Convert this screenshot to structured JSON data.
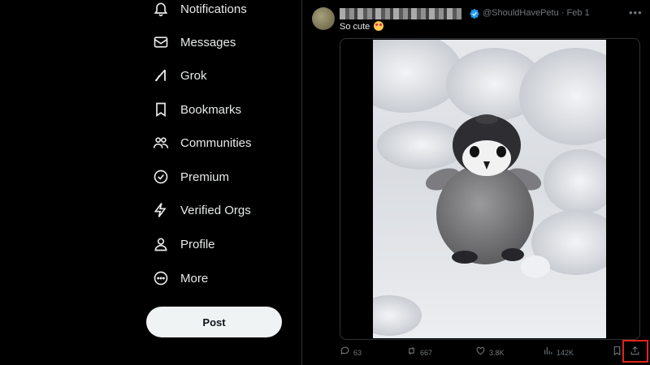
{
  "sidebar": {
    "items": [
      {
        "label": "Notifications",
        "icon": "bell-icon"
      },
      {
        "label": "Messages",
        "icon": "envelope-icon"
      },
      {
        "label": "Grok",
        "icon": "grok-icon"
      },
      {
        "label": "Bookmarks",
        "icon": "bookmark-icon"
      },
      {
        "label": "Communities",
        "icon": "people-icon"
      },
      {
        "label": "Premium",
        "icon": "premium-badge-icon"
      },
      {
        "label": "Verified Orgs",
        "icon": "lightning-icon"
      },
      {
        "label": "Profile",
        "icon": "person-icon"
      },
      {
        "label": "More",
        "icon": "more-circle-icon"
      }
    ],
    "post_label": "Post"
  },
  "tweet": {
    "handle": "@ShouldHavePetu · Feb 1",
    "text": "So cute",
    "actions": {
      "replies": "63",
      "reposts": "667",
      "likes": "3.8K",
      "views": "142K"
    }
  },
  "colors": {
    "background": "#000000",
    "text": "#e7e9ea",
    "muted": "#71767b",
    "verified": "#1d9bf0",
    "post_button_bg": "#eff3f4",
    "highlight": "#e0241a"
  }
}
